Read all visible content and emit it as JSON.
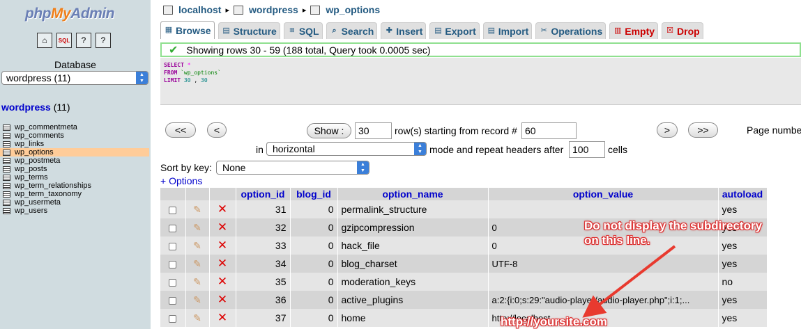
{
  "sidebar": {
    "logo": {
      "php": "php",
      "my": "My",
      "admin": "Admin"
    },
    "database_label": "Database",
    "database_select": "wordpress (11)",
    "db_name": "wordpress",
    "db_count": "(11)",
    "tables": [
      "wp_commentmeta",
      "wp_comments",
      "wp_links",
      "wp_options",
      "wp_postmeta",
      "wp_posts",
      "wp_terms",
      "wp_term_relationships",
      "wp_term_taxonomy",
      "wp_usermeta",
      "wp_users"
    ],
    "active_table": "wp_options",
    "icons": [
      "home-icon",
      "sql-icon",
      "query-window-icon",
      "docs-icon"
    ]
  },
  "breadcrumb": {
    "server": "localhost",
    "database": "wordpress",
    "table": "wp_options",
    "separator": "▸"
  },
  "tabs": [
    {
      "label": "Browse",
      "icon": "▦",
      "active": true
    },
    {
      "label": "Structure",
      "icon": "▤"
    },
    {
      "label": "SQL",
      "icon": "⌗"
    },
    {
      "label": "Search",
      "icon": "⌕"
    },
    {
      "label": "Insert",
      "icon": "✚"
    },
    {
      "label": "Export",
      "icon": "▤"
    },
    {
      "label": "Import",
      "icon": "▤"
    },
    {
      "label": "Operations",
      "icon": "✂"
    },
    {
      "label": "Empty",
      "icon": "▥",
      "danger": true
    },
    {
      "label": "Drop",
      "icon": "☒",
      "danger": true
    }
  ],
  "message": "Showing rows 30 - 59 (188 total, Query took 0.0005 sec)",
  "sql": {
    "select": "SELECT",
    "star": "*",
    "from": "FROM",
    "table": "`wp_options`",
    "limit": "LIMIT",
    "offset": "30",
    "comma": ",",
    "count": "30"
  },
  "nav": {
    "first": "<<",
    "prev": "<",
    "show_button": "Show :",
    "rows_value": "30",
    "rows_label": "row(s) starting from record #",
    "start_value": "60",
    "next": ">",
    "last": ">>",
    "page_number": "Page number",
    "in_label": "in",
    "mode_select": "horizontal",
    "mode_label": "mode and repeat headers after",
    "headers_value": "100",
    "cells_label": "cells",
    "sort_label": "Sort by key:",
    "sort_select": "None",
    "options_link": "+ Options"
  },
  "table": {
    "columns": [
      "option_id",
      "blog_id",
      "option_name",
      "option_value",
      "autoload"
    ],
    "rows": [
      {
        "option_id": "31",
        "blog_id": "0",
        "option_name": "permalink_structure",
        "option_value": "",
        "autoload": "yes"
      },
      {
        "option_id": "32",
        "blog_id": "0",
        "option_name": "gzipcompression",
        "option_value": "0",
        "autoload": "yes"
      },
      {
        "option_id": "33",
        "blog_id": "0",
        "option_name": "hack_file",
        "option_value": "0",
        "autoload": "yes"
      },
      {
        "option_id": "34",
        "blog_id": "0",
        "option_name": "blog_charset",
        "option_value": "UTF-8",
        "autoload": "yes"
      },
      {
        "option_id": "35",
        "blog_id": "0",
        "option_name": "moderation_keys",
        "option_value": "",
        "autoload": "no"
      },
      {
        "option_id": "36",
        "blog_id": "0",
        "option_name": "active_plugins",
        "option_value": "a:2:{i:0;s:29:\"audio-player/audio-player.php\";i:1;...",
        "autoload": "yes"
      },
      {
        "option_id": "37",
        "blog_id": "0",
        "option_name": "home",
        "option_value": "http://localhost",
        "autoload": "yes"
      }
    ]
  },
  "annotation": {
    "line1": "Do not display the subdirectory",
    "line2": "on this line.",
    "url": "http://yoursite.com",
    "color": "#e83a2f"
  }
}
